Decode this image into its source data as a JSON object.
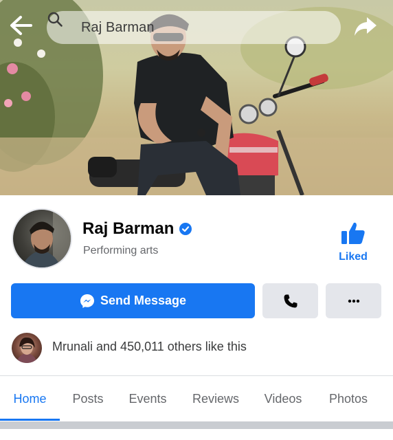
{
  "header": {
    "search_text": "Raj Barman",
    "icons": [
      "back-arrow-icon",
      "search-icon",
      "share-icon"
    ]
  },
  "profile": {
    "name": "Raj Barman",
    "category": "Performing arts",
    "verified_icon": "verified-badge-icon",
    "liked_label": "Liked"
  },
  "actions": {
    "send_message_label": "Send Message",
    "call_icon": "phone-icon",
    "more_icon": "more-dots-icon"
  },
  "likes": {
    "text": "Mrunali and 450,011 others like this"
  },
  "tabs": [
    {
      "label": "Home",
      "active": true
    },
    {
      "label": "Posts",
      "active": false
    },
    {
      "label": "Events",
      "active": false
    },
    {
      "label": "Reviews",
      "active": false
    },
    {
      "label": "Videos",
      "active": false
    },
    {
      "label": "Photos",
      "active": false
    }
  ],
  "colors": {
    "accent": "#1877f2",
    "secondary_button": "#e4e6eb",
    "secondary_text": "#65676b"
  }
}
